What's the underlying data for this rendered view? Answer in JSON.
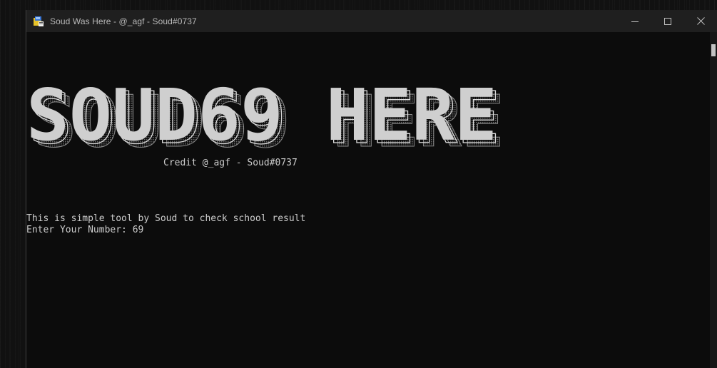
{
  "window": {
    "title": "Soud Was Here - @_agf - Soud#0737",
    "icons": {
      "app": "console-app-icon",
      "minimize": "minimize-icon",
      "maximize": "maximize-icon",
      "close": "close-icon"
    }
  },
  "console": {
    "banner_text": "SOUD69 HERE",
    "credit": "Credit @_agf - Soud#0737",
    "lines": [
      "This is simple tool by Soud to check school result",
      "Enter Your Number: 69"
    ]
  },
  "colors": {
    "console_bg": "#0c0c0c",
    "titlebar_bg": "#1f1f1f",
    "text": "#cccccc",
    "banner_fill": "#cfcfcf"
  }
}
